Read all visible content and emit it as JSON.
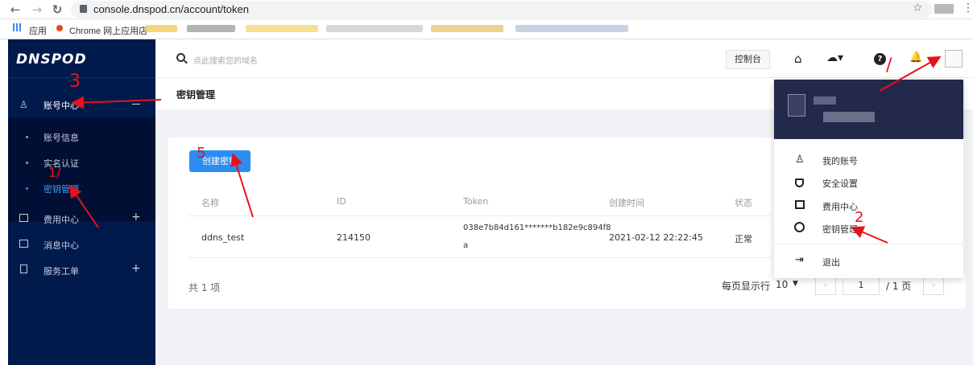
{
  "browser": {
    "url": "console.dnspod.cn/account/token",
    "bookmarks": {
      "apps_label": "应用",
      "chrome_store_label": "Chrome 网上应用店"
    }
  },
  "sidebar": {
    "logo": "DNSPOD",
    "account_center": "账号中心",
    "account_info": "账号信息",
    "realname": "实名认证",
    "key_mgmt": "密钥管理",
    "billing": "费用中心",
    "messages": "消息中心",
    "tickets": "服务工单"
  },
  "header": {
    "search_placeholder": "点此搜索您的域名",
    "console_button": "控制台"
  },
  "page": {
    "title": "密钥管理"
  },
  "card": {
    "create_button": "创建密钥",
    "columns": [
      "名称",
      "ID",
      "Token",
      "创建时间",
      "状态"
    ],
    "row": {
      "name": "ddns_test",
      "id": "214150",
      "token_line1": "038e7b84d161*******b182e9c894f8",
      "token_line2": "a",
      "created": "2021-02-12 22:22:45",
      "status": "正常"
    },
    "total": "共 1 项",
    "per_page_label": "每页显示行",
    "per_page_value": "10",
    "page_input": "1",
    "page_total": "/ 1 页"
  },
  "dropdown": {
    "my_account": "我的账号",
    "security": "安全设置",
    "billing": "费用中心",
    "key_mgmt": "密钥管理",
    "logout": "退出"
  },
  "annotations": {
    "one_top": "/",
    "one_sidebar": "1/",
    "two": "2",
    "three": "3",
    "five": "5"
  },
  "colors": {
    "sidebar": "#001a4c",
    "primary": "#2d8cf0",
    "annotation": "#e8121a",
    "dropdown_header": "#23294a"
  },
  "icons": [
    "back-icon",
    "forward-icon",
    "reload-icon",
    "lock-icon",
    "star-icon",
    "apps-icon",
    "search-icon",
    "home-icon",
    "cloud-icon",
    "help-icon",
    "bell-icon",
    "avatar",
    "user-icon",
    "shield-icon",
    "billing-icon",
    "key-icon",
    "logout-icon",
    "message-icon",
    "ticket-icon"
  ]
}
